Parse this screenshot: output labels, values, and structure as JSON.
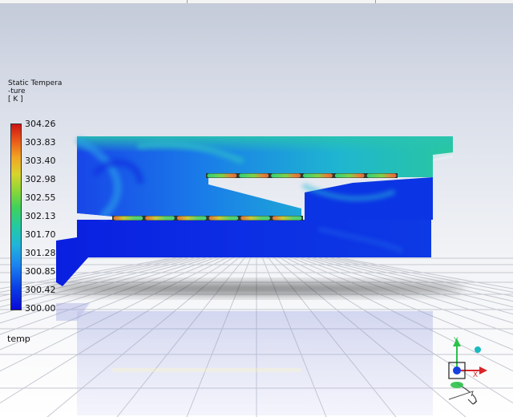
{
  "legend": {
    "title_lines": [
      "Static Tempera",
      "-ture",
      "[ K ]"
    ],
    "ticks": [
      "304.26",
      "303.83",
      "303.40",
      "302.98",
      "302.55",
      "302.13",
      "301.70",
      "301.28",
      "300.85",
      "300.42",
      "300.00"
    ]
  },
  "variable_label": "temp",
  "colors": {
    "cold": "#0a1fe0",
    "mid": "#24c2b8",
    "hot": "#cc1414"
  },
  "triad": {
    "x_label": "X",
    "y_label": "Y",
    "z_label": "Z"
  }
}
